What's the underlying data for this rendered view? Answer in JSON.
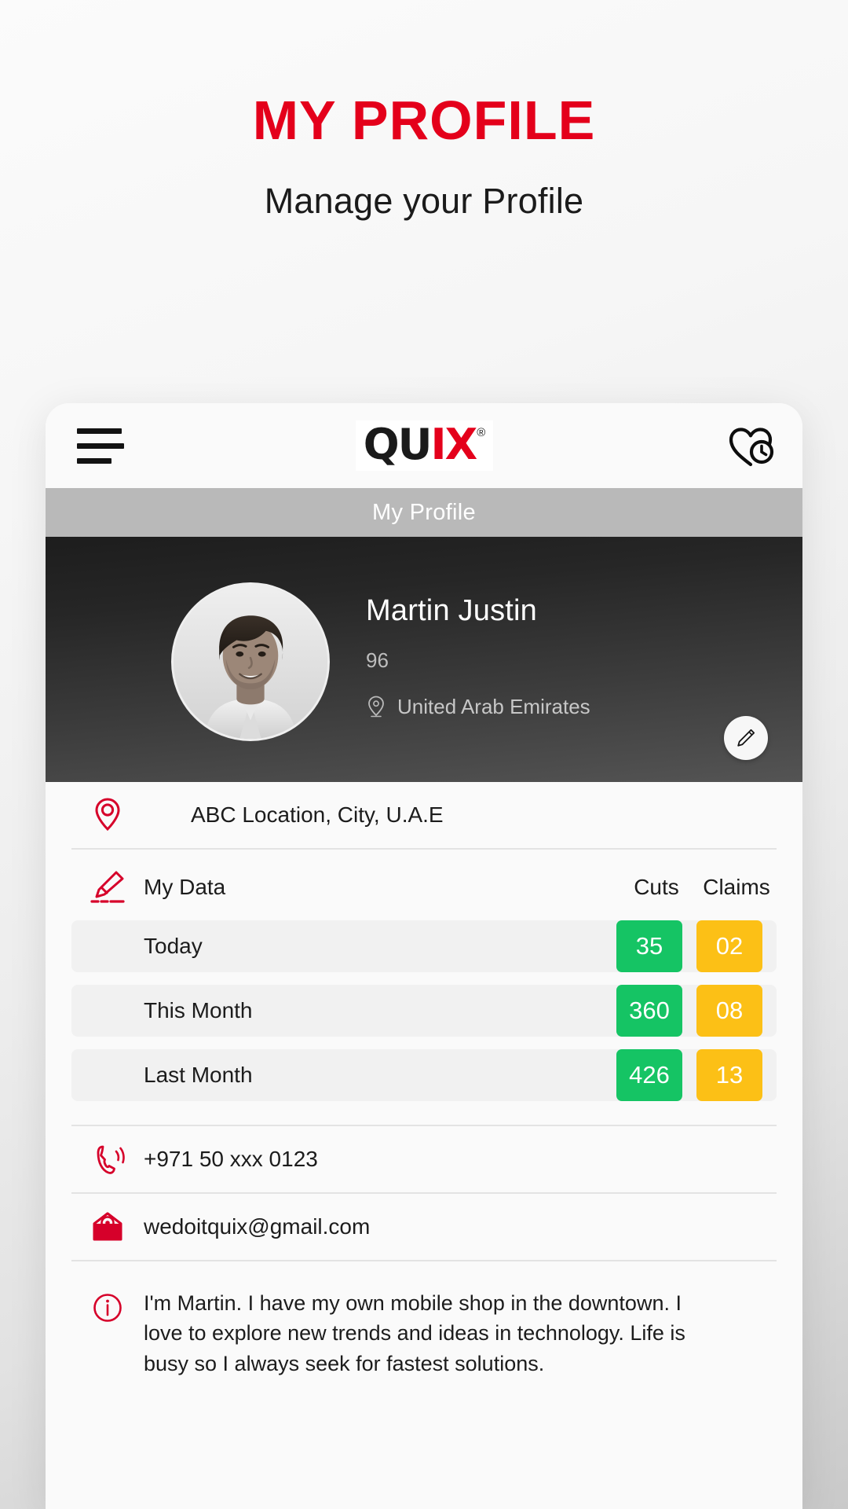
{
  "page": {
    "title": "MY PROFILE",
    "subtitle": "Manage your Profile",
    "accent_color": "#e4001b"
  },
  "app_bar": {
    "menu_icon": "hamburger-icon",
    "brand": {
      "part1": "QU",
      "part2": "I",
      "part3": "X",
      "registered": "®"
    },
    "favorites_icon": "heart-clock-icon"
  },
  "section_bar": {
    "title": "My Profile"
  },
  "hero": {
    "avatar_icon": "user-avatar-photo",
    "name": "Martin Justin",
    "sub": "96",
    "location_icon": "map-pin-icon",
    "location": "United Arab Emirates",
    "edit_icon": "pencil-icon"
  },
  "address": {
    "icon": "location-pin-icon",
    "text": "ABC Location, City, U.A.E"
  },
  "my_data": {
    "icon": "pen-marker-icon",
    "label": "My Data",
    "columns": [
      "Cuts",
      "Claims"
    ],
    "rows": [
      {
        "label": "Today",
        "cuts": "35",
        "claims": "02"
      },
      {
        "label": "This Month",
        "cuts": "360",
        "claims": "08"
      },
      {
        "label": "Last Month",
        "cuts": "426",
        "claims": "13"
      }
    ],
    "cuts_color": "#15c464",
    "claims_color": "#fcc016"
  },
  "phone": {
    "icon": "phone-ring-icon",
    "value": "+971 50 xxx 0123"
  },
  "email": {
    "icon": "envelope-at-icon",
    "value": "wedoitquix@gmail.com"
  },
  "bio": {
    "icon": "info-circle-icon",
    "text": "I'm Martin. I have my own mobile shop in the downtown. I love to explore new trends and ideas  in technology. Life is busy so I always seek for fastest solutions."
  }
}
